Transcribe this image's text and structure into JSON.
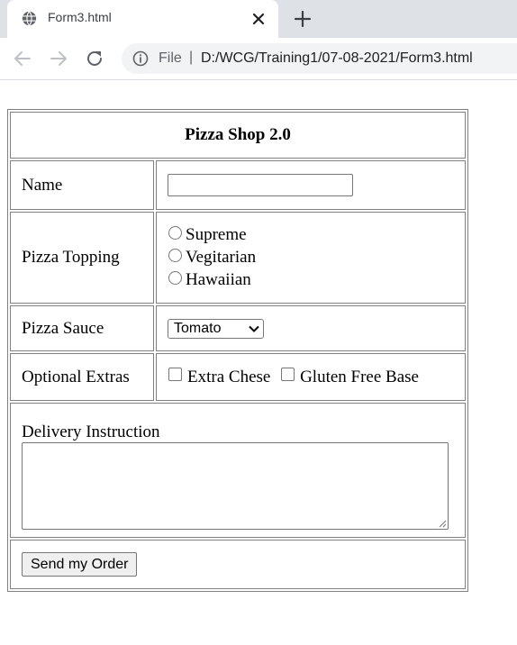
{
  "browser": {
    "tab_title": "Form3.html",
    "scheme_label": "File",
    "url": "D:/WCG/Training1/07-08-2021/Form3.html",
    "icons": {
      "favicon": "globe-icon",
      "close": "close-icon",
      "new_tab": "plus-icon",
      "back": "back-arrow-icon",
      "forward": "forward-arrow-icon",
      "reload": "reload-icon",
      "info": "info-icon"
    }
  },
  "form": {
    "title": "Pizza Shop 2.0",
    "name_label": "Name",
    "name_value": "",
    "topping_label": "Pizza Topping",
    "toppings": [
      "Supreme",
      "Vegitarian",
      "Hawaiian"
    ],
    "sauce_label": "Pizza Sauce",
    "sauce_selected": "Tomato",
    "extras_label": "Optional Extras",
    "extras": [
      "Extra Chese",
      "Gluten Free Base"
    ],
    "delivery_label": "Delivery Instruction",
    "delivery_value": "",
    "submit_label": "Send my Order"
  },
  "colors": {
    "tabstrip_bg": "#dee1e6",
    "omnibox_bg": "#f1f3f4",
    "border": "#808080",
    "button_bg": "#efefef"
  }
}
